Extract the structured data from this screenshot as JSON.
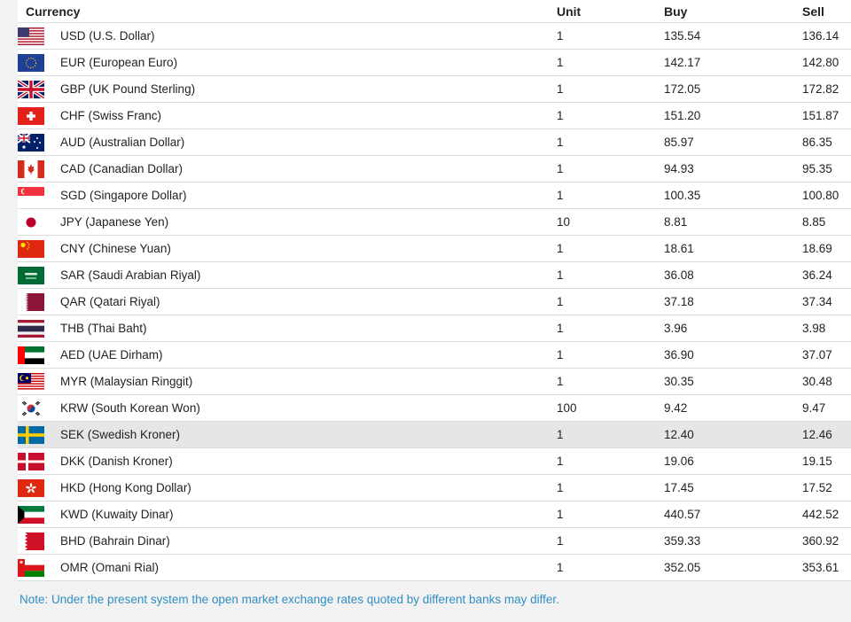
{
  "headers": {
    "currency": "Currency",
    "unit": "Unit",
    "buy": "Buy",
    "sell": "Sell"
  },
  "rows": [
    {
      "flag": "us-flag-icon",
      "currency": "USD (U.S. Dollar)",
      "unit": "1",
      "buy": "135.54",
      "sell": "136.14"
    },
    {
      "flag": "eu-flag-icon",
      "currency": "EUR (European Euro)",
      "unit": "1",
      "buy": "142.17",
      "sell": "142.80"
    },
    {
      "flag": "gb-flag-icon",
      "currency": "GBP (UK Pound Sterling)",
      "unit": "1",
      "buy": "172.05",
      "sell": "172.82"
    },
    {
      "flag": "ch-flag-icon",
      "currency": "CHF (Swiss Franc)",
      "unit": "1",
      "buy": "151.20",
      "sell": "151.87"
    },
    {
      "flag": "au-flag-icon",
      "currency": "AUD (Australian Dollar)",
      "unit": "1",
      "buy": "85.97",
      "sell": "86.35"
    },
    {
      "flag": "ca-flag-icon",
      "currency": "CAD (Canadian Dollar)",
      "unit": "1",
      "buy": "94.93",
      "sell": "95.35"
    },
    {
      "flag": "sg-flag-icon",
      "currency": "SGD (Singapore Dollar)",
      "unit": "1",
      "buy": "100.35",
      "sell": "100.80"
    },
    {
      "flag": "jp-flag-icon",
      "currency": "JPY (Japanese Yen)",
      "unit": "10",
      "buy": "8.81",
      "sell": "8.85"
    },
    {
      "flag": "cn-flag-icon",
      "currency": "CNY (Chinese Yuan)",
      "unit": "1",
      "buy": "18.61",
      "sell": "18.69"
    },
    {
      "flag": "sa-flag-icon",
      "currency": "SAR (Saudi Arabian Riyal)",
      "unit": "1",
      "buy": "36.08",
      "sell": "36.24"
    },
    {
      "flag": "qa-flag-icon",
      "currency": "QAR (Qatari Riyal)",
      "unit": "1",
      "buy": "37.18",
      "sell": "37.34"
    },
    {
      "flag": "th-flag-icon",
      "currency": "THB (Thai Baht)",
      "unit": "1",
      "buy": "3.96",
      "sell": "3.98"
    },
    {
      "flag": "ae-flag-icon",
      "currency": "AED (UAE Dirham)",
      "unit": "1",
      "buy": "36.90",
      "sell": "37.07"
    },
    {
      "flag": "my-flag-icon",
      "currency": "MYR (Malaysian Ringgit)",
      "unit": "1",
      "buy": "30.35",
      "sell": "30.48"
    },
    {
      "flag": "kr-flag-icon",
      "currency": "KRW (South Korean Won)",
      "unit": "100",
      "buy": "9.42",
      "sell": "9.47"
    },
    {
      "flag": "se-flag-icon",
      "currency": "SEK (Swedish Kroner)",
      "unit": "1",
      "buy": "12.40",
      "sell": "12.46",
      "highlighted": true
    },
    {
      "flag": "dk-flag-icon",
      "currency": "DKK (Danish Kroner)",
      "unit": "1",
      "buy": "19.06",
      "sell": "19.15"
    },
    {
      "flag": "hk-flag-icon",
      "currency": "HKD (Hong Kong Dollar)",
      "unit": "1",
      "buy": "17.45",
      "sell": "17.52"
    },
    {
      "flag": "kw-flag-icon",
      "currency": "KWD (Kuwaity Dinar)",
      "unit": "1",
      "buy": "440.57",
      "sell": "442.52"
    },
    {
      "flag": "bh-flag-icon",
      "currency": "BHD (Bahrain Dinar)",
      "unit": "1",
      "buy": "359.33",
      "sell": "360.92"
    },
    {
      "flag": "om-flag-icon",
      "currency": "OMR (Omani Rial)",
      "unit": "1",
      "buy": "352.05",
      "sell": "353.61"
    }
  ],
  "note": "Note: Under the present system the open market exchange rates quoted by different banks may differ.",
  "colors": {
    "note": "#2f8fc4",
    "highlight_row": "#e6e6e6",
    "border": "#dcdcdc"
  }
}
